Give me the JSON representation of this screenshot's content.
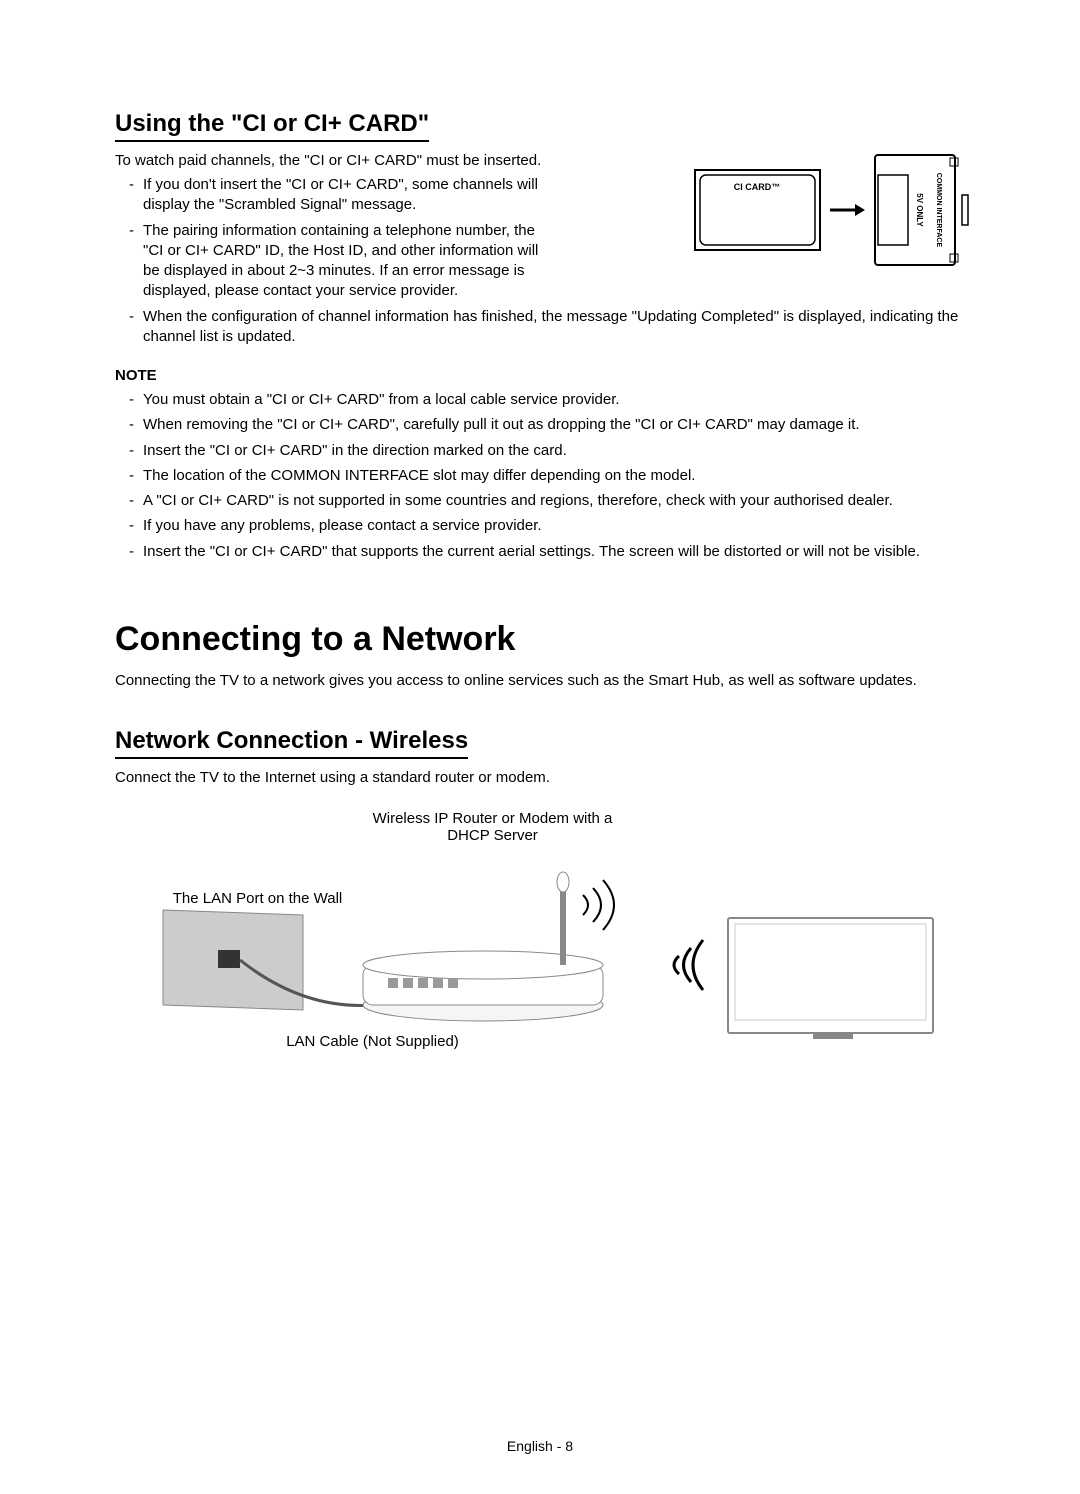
{
  "section1": {
    "heading": "Using the \"CI or CI+ CARD\"",
    "intro": "To watch paid channels, the \"CI or CI+ CARD\" must be inserted.",
    "bullets_narrow": [
      "If you don't insert the \"CI or CI+ CARD\", some channels will display the \"Scrambled Signal\" message.",
      "The pairing information containing a telephone number, the \"CI or CI+ CARD\" ID, the Host ID, and other information will be displayed in about 2~3 minutes. If an error message is displayed, please contact your service provider."
    ],
    "bullets_wide": [
      "When the configuration of channel information has finished, the message \"Updating Completed\" is displayed, indicating the channel list is updated."
    ],
    "illustration": {
      "card_label": "CI CARD™",
      "slot_label_1": "5V ONLY",
      "slot_label_2": "COMMON INTERFACE"
    }
  },
  "note": {
    "title": "NOTE",
    "bullets": [
      "You must obtain a \"CI or CI+ CARD\" from a local cable service provider.",
      "When removing the \"CI or CI+ CARD\", carefully pull it out as dropping the \"CI or CI+ CARD\" may damage it.",
      "Insert the \"CI or CI+ CARD\" in the direction marked on the card.",
      "The location of the COMMON INTERFACE slot may differ depending on the model.",
      "A \"CI or CI+ CARD\" is not supported in some countries and regions, therefore, check with your authorised dealer.",
      "If you have any problems, please contact a service provider.",
      "Insert the \"CI or CI+ CARD\" that supports the current aerial settings. The screen will be distorted or will not be visible."
    ]
  },
  "section2": {
    "heading": "Connecting to a Network",
    "intro": "Connecting the TV to a network gives you access to online services such as the Smart Hub, as well as software updates."
  },
  "section3": {
    "heading": "Network Connection - Wireless",
    "intro": "Connect the TV to the Internet using a standard router or modem.",
    "diagram": {
      "router_label": "Wireless IP Router or Modem with a DHCP Server",
      "wall_label": "The LAN Port on the Wall",
      "lan_label": "LAN Cable (Not Supplied)"
    }
  },
  "footer": {
    "language": "English",
    "page": "8"
  }
}
